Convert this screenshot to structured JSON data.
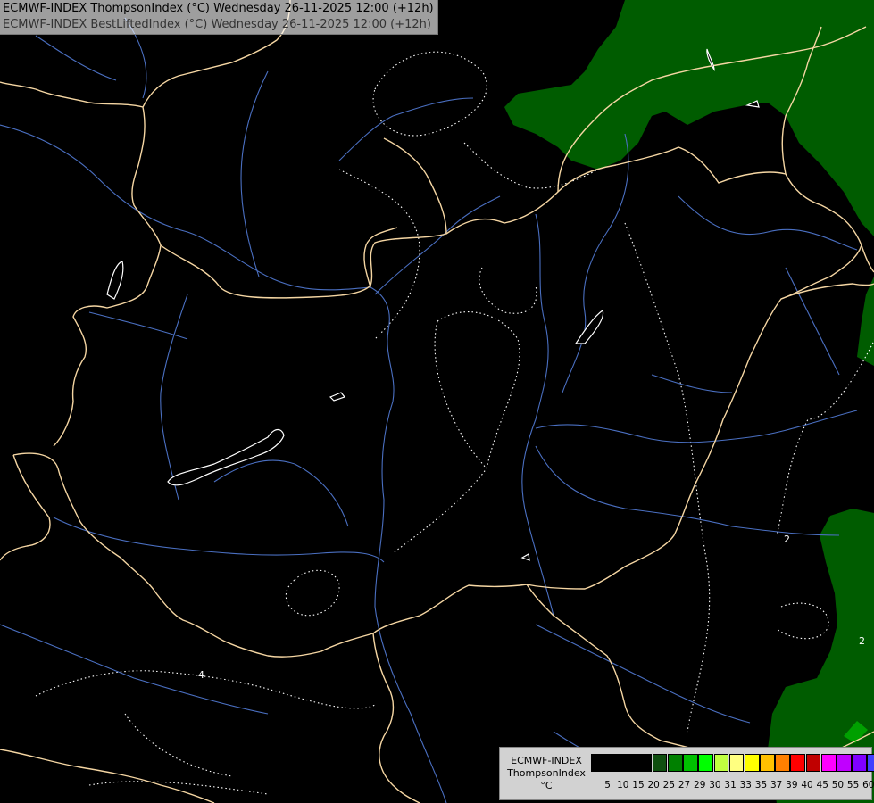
{
  "header": {
    "line1": "ECMWF-INDEX ThompsonIndex (°C) Wednesday 26-11-2025 12:00 (+12h)",
    "line2": "ECMWF-INDEX BestLiftedIndex (°C) Wednesday 26-11-2025 12:00 (+12h)"
  },
  "legend": {
    "title": "ECMWF-INDEX",
    "param": "ThompsonIndex",
    "unit": "°C",
    "colors": [
      "#000000",
      "#000000",
      "#000000",
      "#000000",
      "#0f4f0f",
      "#008000",
      "#00c000",
      "#00ff00",
      "#c0ff40",
      "#ffff80",
      "#ffff00",
      "#ffc000",
      "#ff8000",
      "#ff0000",
      "#c00000",
      "#ff00ff",
      "#c000ff",
      "#8000ff",
      "#4040ff",
      "#0000ff"
    ],
    "ticks": [
      "5",
      "10",
      "15",
      "20",
      "25",
      "27",
      "29",
      "30",
      "31",
      "33",
      "35",
      "37",
      "39",
      "40",
      "45",
      "50",
      "55",
      "60"
    ]
  },
  "map": {
    "region": "Hungary and surroundings",
    "contour_labels": [
      "4",
      "2",
      "2"
    ],
    "colors": {
      "background": "#000000",
      "shaded_green": "#005c00",
      "border": "#f5d6a3",
      "rivers": "#4a6fc1",
      "lakes": "#ffffff",
      "contours": "#ffffff"
    }
  }
}
